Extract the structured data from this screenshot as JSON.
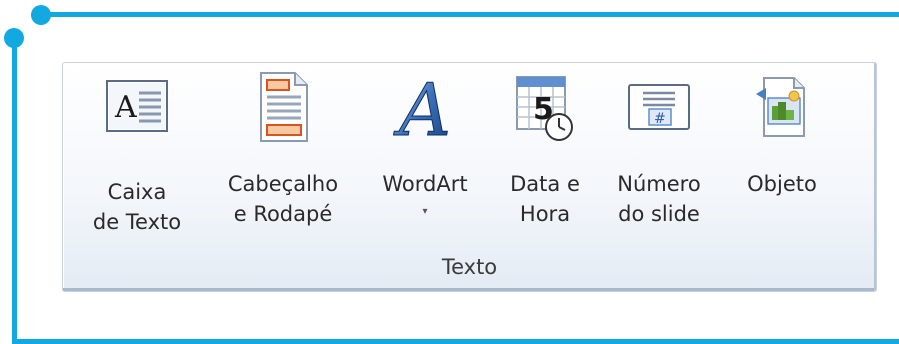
{
  "group": {
    "label": "Texto"
  },
  "buttons": [
    {
      "id": "caixa-de-texto",
      "line1": "Caixa",
      "line2": "de Texto",
      "icon": "textbox-icon"
    },
    {
      "id": "cabecalho-rodape",
      "line1": "Cabeçalho",
      "line2": "e Rodapé",
      "icon": "header-footer-icon"
    },
    {
      "id": "wordart",
      "line1": "WordArt",
      "line2": "",
      "icon": "wordart-icon",
      "has_dropdown": true,
      "dropdown_glyph": "▾"
    },
    {
      "id": "data-hora",
      "line1": "Data e",
      "line2": "Hora",
      "icon": "date-time-icon",
      "icon_digit": "5"
    },
    {
      "id": "numero-slide",
      "line1": "Número",
      "line2": "do slide",
      "icon": "slide-number-icon",
      "icon_symbol": "#"
    },
    {
      "id": "objeto",
      "line1": "Objeto",
      "line2": "",
      "icon": "object-icon"
    }
  ],
  "icon_text": {
    "textbox_letter": "A",
    "wordart_letter": "A"
  },
  "colors": {
    "frame": "#12a9e0",
    "ribbon_border": "#c6d2e0"
  }
}
